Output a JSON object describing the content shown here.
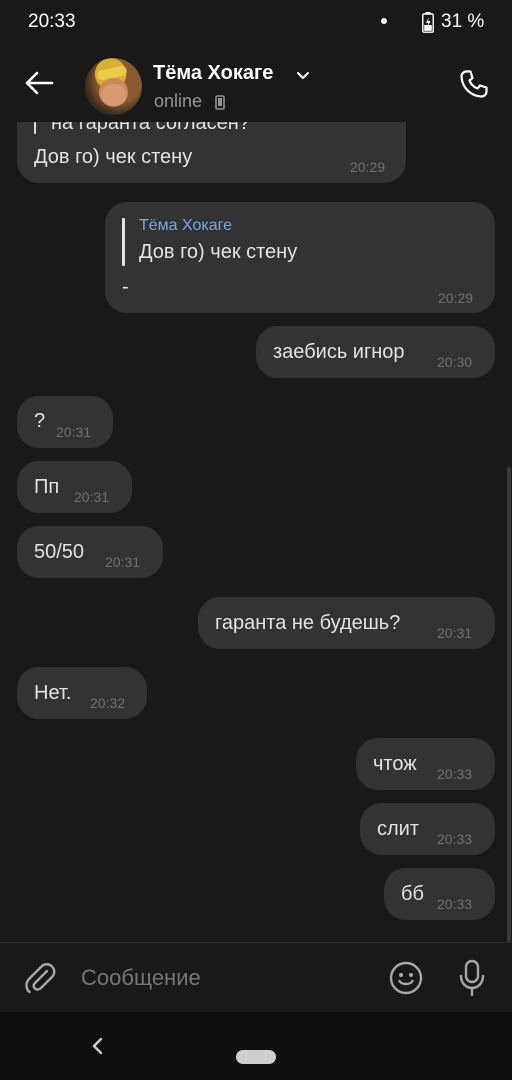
{
  "status_bar": {
    "time": "20:33",
    "battery": "31 %"
  },
  "header": {
    "contact_name": "Тёма Хокаге",
    "status": "online"
  },
  "messages": [
    {
      "dir": "in",
      "quote_text": "на гаранта согласен?",
      "text": "Дов го) чек стену",
      "time": "20:29"
    },
    {
      "dir": "out",
      "reply_author": "Тёма Хокаге",
      "reply_text": "Дов го) чек стену",
      "text": "-",
      "time": "20:29"
    },
    {
      "dir": "out",
      "text": "заебись игнор",
      "time": "20:30"
    },
    {
      "dir": "in",
      "text": "?",
      "time": "20:31"
    },
    {
      "dir": "in",
      "text": "Пп",
      "time": "20:31"
    },
    {
      "dir": "in",
      "text": "50/50",
      "time": "20:31"
    },
    {
      "dir": "out",
      "text": "гаранта не будешь?",
      "time": "20:31"
    },
    {
      "dir": "in",
      "text": "Нет.",
      "time": "20:32"
    },
    {
      "dir": "out",
      "text": "чтож",
      "time": "20:33"
    },
    {
      "dir": "out",
      "text": "слит",
      "time": "20:33"
    },
    {
      "dir": "out",
      "text": "бб",
      "time": "20:33"
    }
  ],
  "composer": {
    "placeholder": "Сообщение"
  },
  "colors": {
    "background": "#191919",
    "bubble": "#333333",
    "reply_author": "#71aaeb",
    "text": "#e1e3e6",
    "time": "#707070"
  },
  "icons": [
    "back-arrow-icon",
    "chevron-down-icon",
    "phone-icon",
    "attach-icon",
    "emoji-icon",
    "mic-icon",
    "battery-icon",
    "mobile-device-icon"
  ]
}
